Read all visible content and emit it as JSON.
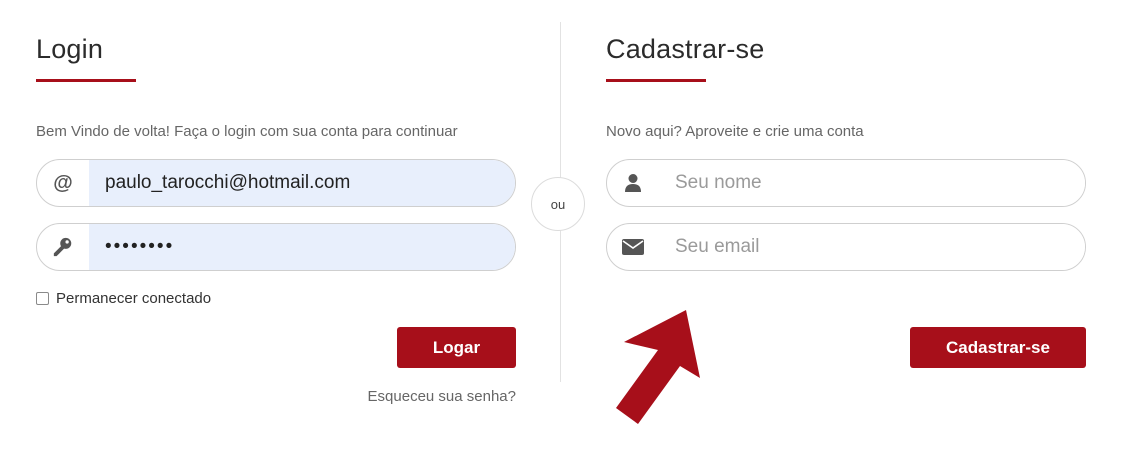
{
  "login": {
    "title": "Login",
    "subtitle": "Bem Vindo de volta! Faça o login com sua conta para continuar",
    "email_value": "paulo_tarocchi@hotmail.com",
    "email_icon_glyph": "@",
    "password_value": "••••••••",
    "remember_label": "Permanecer conectado",
    "remember_checked": false,
    "submit_label": "Logar",
    "forgot_label": "Esqueceu sua senha?"
  },
  "separator": {
    "label": "ou"
  },
  "register": {
    "title": "Cadastrar-se",
    "subtitle": "Novo aqui? Aproveite e crie uma conta",
    "name_placeholder": "Seu nome",
    "email_placeholder": "Seu email",
    "submit_label": "Cadastrar-se"
  },
  "icons": {
    "email": "at-sign-icon",
    "password": "key-icon",
    "name": "user-icon",
    "register_email": "envelope-icon",
    "annotation": "arrow-up-icon"
  },
  "colors": {
    "accent": "#a70f1a",
    "input_fill": "#e8effc",
    "muted_text": "#666666"
  }
}
